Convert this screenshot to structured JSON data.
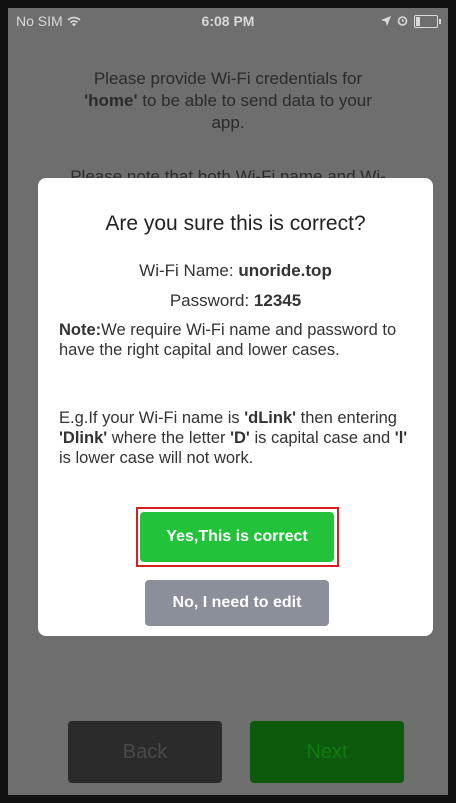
{
  "status_bar": {
    "carrier": "No SIM",
    "wifi_icon": "wifi-icon",
    "time": "6:08 PM",
    "location_icon": "location-arrow-icon",
    "alarm_icon": "alarm-icon",
    "battery_icon": "battery-icon"
  },
  "background": {
    "line1": "Please provide Wi-Fi credentials for",
    "line2_bold": "'home'",
    "line2_rest": " to be able to send data to your",
    "line3": "app.",
    "line4": "Please note that both Wi-Fi name and Wi-",
    "back_label": "Back",
    "next_label": "Next"
  },
  "dialog": {
    "title": "Are you sure this is correct?",
    "wifi_name_label": "Wi-Fi Name: ",
    "wifi_name_value": "unoride.top",
    "password_label": "Password: ",
    "password_value": "12345",
    "note_label": "Note:",
    "note_text": "We require Wi-Fi name and password to have the right capital and lower cases.",
    "example_1": "E.g.If your Wi-Fi name is ",
    "example_name": "'dLink'",
    "example_2": " then entering ",
    "example_wrong": "'Dlink'",
    "example_3": " where the letter ",
    "example_d": "'D'",
    "example_4": " is capital case and ",
    "example_l": "'l'",
    "example_5": " is lower case will not work.",
    "confirm_label": "Yes,This is correct",
    "edit_label": "No, I need to edit"
  },
  "colors": {
    "confirm": "#22c33a",
    "edit": "#8a8f99",
    "highlight": "#d62020"
  }
}
